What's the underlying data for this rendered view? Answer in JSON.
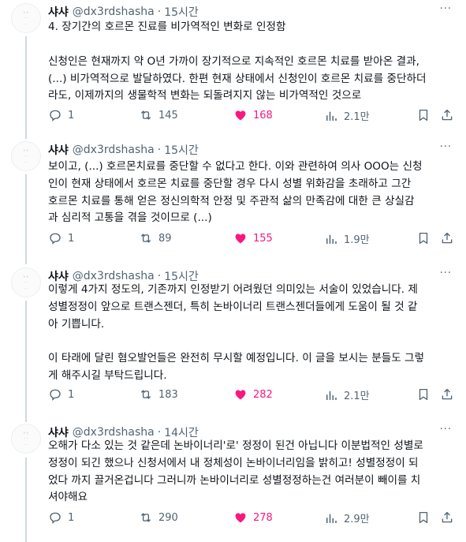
{
  "tweets": [
    {
      "name": "샤샤",
      "handle": "@dx3rdshasha",
      "time": "15시간",
      "paragraphs": [
        "4. 장기간의 호르몬 진료를 비가역적인 변화로 인정함",
        "신청인은 현재까지 약 O년 가까이 장기적으로 지속적인 호르몬 치료를 받아온 결과,\n(...) 비가역적으로 발달하였다. 한편 현재 상태에서 신청인이 호르몬 치료를 중단하더\n라도, 이제까지의 생물학적 변화는 되돌려지지 않는 비가역적인 것으로"
      ],
      "replies": "1",
      "retweets": "145",
      "likes": "168",
      "views": "2.1만"
    },
    {
      "name": "샤샤",
      "handle": "@dx3rdshasha",
      "time": "15시간",
      "paragraphs": [
        "보이고, (...) 호르몬치료를 중단할 수 없다고 한다. 이와 관련하여 의사 OOO는 신청\n인이 현재 상태에서 호르몬 치료를 중단할 경우 다시 성별 위화감을 초래하고 그간\n호르몬 치료를 통해 얻은 정신의학적 안정 및 주관적 삶의 만족감에 대한 큰 상실감\n과 심리적 고통을 겪을 것이므로 (...)"
      ],
      "replies": "1",
      "retweets": "89",
      "likes": "155",
      "views": "1.9만"
    },
    {
      "name": "샤샤",
      "handle": "@dx3rdshasha",
      "time": "15시간",
      "paragraphs": [
        "이렇게 4가지 정도의, 기존까지 인정받기 어려웠던 의미있는 서술이 있었습니다. 제\n성별정정이 앞으로 트랜스젠더, 특히 논바이너리 트랜스젠더들에게 도움이 될 것 같\n아 기쁩니다.",
        "이 타래에 달린 혐오발언들은 완전히 무시할 예정입니다. 이 글을 보시는 분들도 그렇\n게 해주시길 부탁드립니다."
      ],
      "replies": "1",
      "retweets": "183",
      "likes": "282",
      "views": "2.1만"
    },
    {
      "name": "샤샤",
      "handle": "@dx3rdshasha",
      "time": "14시간",
      "paragraphs": [
        "오해가 다소 있는 것 같은데 논바이너리'로' 정정이 된건 아닙니다 이분법적인 성별로\n정정이 되긴 했으나 신청서에서 내 정체성이 논바이너리임을 밝히고! 성별정정이 되\n었다 까지 끌거온겁니다 그러니까 논바이너리로 성별정정하는건 여러분이 빼이를 치\n셔야해요"
      ],
      "replies": "1",
      "retweets": "290",
      "likes": "278",
      "views": "2.9만"
    }
  ],
  "icons": {
    "reply": "reply-icon",
    "retweet": "retweet-icon",
    "like": "heart-icon",
    "views": "views-icon",
    "bookmark": "bookmark-icon",
    "share": "share-icon",
    "more": "more-icon"
  },
  "colors": {
    "like": "#f91880",
    "secondary_text": "#536471",
    "thread_line": "#cfd9de"
  }
}
